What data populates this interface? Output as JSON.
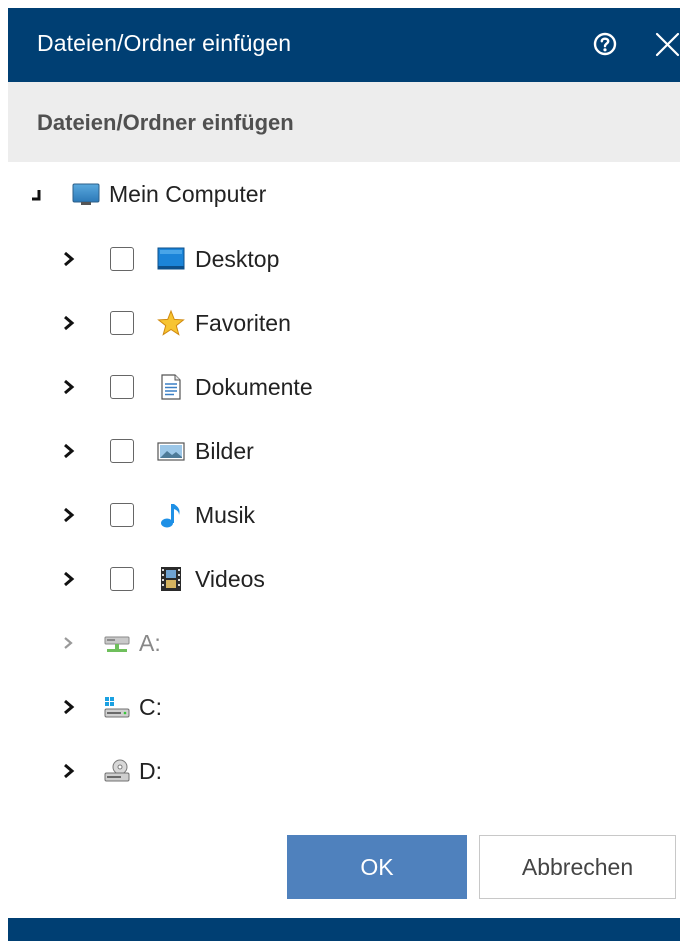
{
  "dialog": {
    "title": "Dateien/Ordner einfügen",
    "subtitle": "Dateien/Ordner einfügen",
    "help_icon": "help-circle-icon",
    "close_icon": "close-icon"
  },
  "tree": {
    "root": {
      "label": "Mein Computer",
      "icon": "monitor-icon",
      "expanded": true
    },
    "folders": [
      {
        "label": "Desktop",
        "icon": "desktop-icon",
        "checked": false
      },
      {
        "label": "Favoriten",
        "icon": "star-icon",
        "checked": false
      },
      {
        "label": "Dokumente",
        "icon": "document-icon",
        "checked": false
      },
      {
        "label": "Bilder",
        "icon": "image-icon",
        "checked": false
      },
      {
        "label": "Musik",
        "icon": "music-note-icon",
        "checked": false
      },
      {
        "label": "Videos",
        "icon": "film-icon",
        "checked": false
      }
    ],
    "drives": [
      {
        "label": "A:",
        "icon": "network-drive-icon",
        "disabled": true
      },
      {
        "label": "C:",
        "icon": "system-drive-icon",
        "disabled": false
      },
      {
        "label": "D:",
        "icon": "cd-drive-icon",
        "disabled": false
      }
    ]
  },
  "buttons": {
    "ok": "OK",
    "cancel": "Abbrechen"
  },
  "colors": {
    "header": "#003f73",
    "subheader": "#ededed",
    "primary_button": "#4f81bd",
    "disabled_text": "#888888"
  }
}
